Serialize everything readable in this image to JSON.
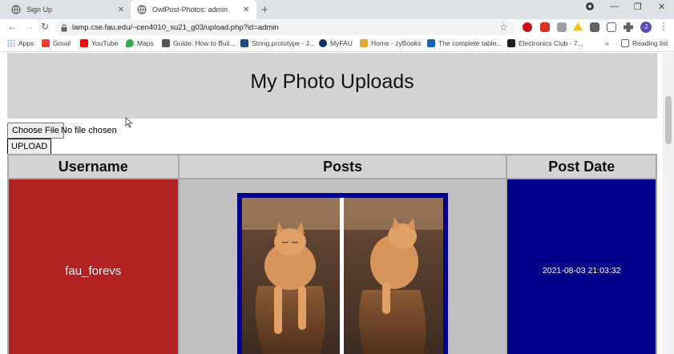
{
  "browser": {
    "tabs": [
      {
        "title": "Sign Up",
        "active": false
      },
      {
        "title": "OwlPost-Photos: admin",
        "active": true
      }
    ],
    "address": {
      "url": "lamp.cse.fau.edu/~cen4010_su21_g03/upload.php?id=admin"
    },
    "profile_initial": "J",
    "bookmarks": [
      {
        "label": "Apps",
        "icon": "apps-grid-icon",
        "color": "#4285f4"
      },
      {
        "label": "Gmail",
        "icon": "gmail-icon",
        "color": "#ea4335"
      },
      {
        "label": "YouTube",
        "icon": "youtube-icon",
        "color": "#ff0000"
      },
      {
        "label": "Maps",
        "icon": "maps-pin-icon",
        "color": "#34a853"
      },
      {
        "label": "Guide: How to Buil...",
        "icon": "guide-icon",
        "color": "#555555"
      },
      {
        "label": "String.prototype - J...",
        "icon": "mdn-icon",
        "color": "#1a4d8c"
      },
      {
        "label": "MyFAU",
        "icon": "fau-owl-icon",
        "color": "#003366"
      },
      {
        "label": "Home - zyBooks",
        "icon": "zybooks-icon",
        "color": "#e8a33d"
      },
      {
        "label": "The complete table...",
        "icon": "bookmark-blue-icon",
        "color": "#1565c0"
      },
      {
        "label": "Electronics Club - 7...",
        "icon": "electronics-icon",
        "color": "#222222"
      }
    ],
    "bookmarks_overflow": "»",
    "reading_list": "Reading list"
  },
  "page": {
    "title": "My Photo Uploads",
    "file_input": {
      "button_label": "Choose File",
      "status": "No file chosen"
    },
    "upload_label": "UPLOAD",
    "table": {
      "headers": [
        "Username",
        "Posts",
        "Post Date"
      ],
      "rows": [
        {
          "username": "fau_forevs",
          "post_date": "2021-08-03 21:03:32"
        }
      ]
    }
  },
  "colors": {
    "header_bg": "#d3d3d3",
    "username_bg": "#b22222",
    "posts_bg": "#c0c0c0",
    "date_bg": "#00008b"
  }
}
